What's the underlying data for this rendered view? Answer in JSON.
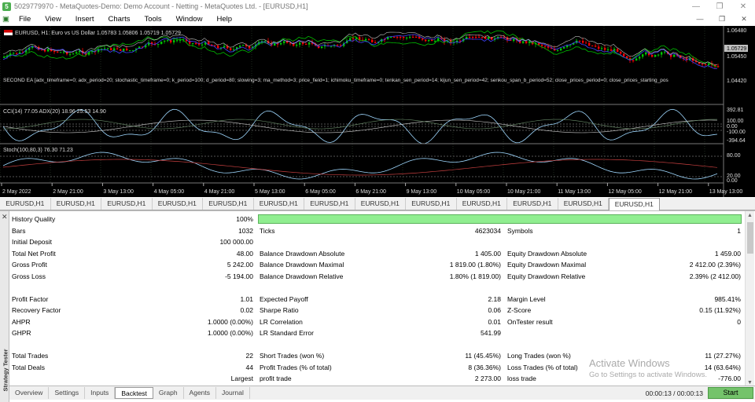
{
  "window": {
    "title": "5029779970 - MetaQuotes-Demo: Demo Account - Netting - MetaQuotes Ltd. - [EURUSD,H1]"
  },
  "menu": [
    "File",
    "View",
    "Insert",
    "Charts",
    "Tools",
    "Window",
    "Help"
  ],
  "chart": {
    "header": "EURUSD, H1:  Euro vs US Dollar  1.05783 1.05806 1.05719 1.05729",
    "price_current": "1.05729",
    "price_labels": [
      "1.06480",
      "1.05450",
      "1.04420"
    ],
    "ea_label": "SECOND EA [adx_timeframe=0; adx_period=20; stochastic_timeframe=0; k_period=100; d_period=80; slowing=3; ma_method=3; price_field=1; ichimoku_timeframe=0; tenkan_sen_period=14; kijun_sen_period=42; senkou_span_b_period=52; close_prices_period=0; close_prices_starting_pos",
    "cci_label": "CCI(14) 77.05 ADX(20) 18.96 25.53 14.90",
    "cci_levels": [
      "392.81",
      "100.00",
      "0.00",
      "-100.00",
      "-394.64"
    ],
    "stoch_label": "Stoch(100,80,3) 76.30 71.23",
    "stoch_levels": [
      "80.00",
      "20.00",
      "0.00"
    ],
    "time_labels": [
      "2 May 2022",
      "2 May 21:00",
      "3 May 13:00",
      "4 May 05:00",
      "4 May 21:00",
      "5 May 13:00",
      "6 May 05:00",
      "6 May 21:00",
      "9 May 13:00",
      "10 May 05:00",
      "10 May 21:00",
      "11 May 13:00",
      "12 May 05:00",
      "12 May 21:00",
      "13 May 13:00"
    ],
    "colors": {
      "bull": "#00c800",
      "bear": "#ff0000",
      "price_line": "#00ff00"
    }
  },
  "chart_tabs": [
    "EURUSD,H1",
    "EURUSD,H1",
    "EURUSD,H1",
    "EURUSD,H1",
    "EURUSD,H1",
    "EURUSD,H1",
    "EURUSD,H1",
    "EURUSD,H1",
    "EURUSD,H1",
    "EURUSD,H1",
    "EURUSD,H1",
    "EURUSD,H1",
    "EURUSD,H1"
  ],
  "active_chart_tab": 12,
  "report": {
    "history_quality": {
      "label": "History Quality",
      "value": "100%",
      "fraction": 1.0
    },
    "rows": [
      [
        [
          "Bars",
          "1032"
        ],
        [
          "Ticks",
          "4623034"
        ],
        [
          "Symbols",
          "1"
        ]
      ],
      [
        [
          "Initial Deposit",
          "100 000.00"
        ],
        [
          "",
          ""
        ],
        [
          "",
          ""
        ]
      ],
      [
        [
          "Total Net Profit",
          "48.00"
        ],
        [
          "Balance Drawdown Absolute",
          "1 405.00"
        ],
        [
          "Equity Drawdown Absolute",
          "1 459.00"
        ]
      ],
      [
        [
          "Gross Profit",
          "5 242.00"
        ],
        [
          "Balance Drawdown Maximal",
          "1 819.00 (1.80%)"
        ],
        [
          "Equity Drawdown Maximal",
          "2 412.00 (2.39%)"
        ]
      ],
      [
        [
          "Gross Loss",
          "-5 194.00"
        ],
        [
          "Balance Drawdown Relative",
          "1.80% (1 819.00)"
        ],
        [
          "Equity Drawdown Relative",
          "2.39% (2 412.00)"
        ]
      ],
      null,
      [
        [
          "Profit Factor",
          "1.01"
        ],
        [
          "Expected Payoff",
          "2.18"
        ],
        [
          "Margin Level",
          "985.41%"
        ]
      ],
      [
        [
          "Recovery Factor",
          "0.02"
        ],
        [
          "Sharpe Ratio",
          "0.06"
        ],
        [
          "Z-Score",
          "0.15 (11.92%)"
        ]
      ],
      [
        [
          "AHPR",
          "1.0000 (0.00%)"
        ],
        [
          "LR Correlation",
          "0.01"
        ],
        [
          "OnTester result",
          "0"
        ]
      ],
      [
        [
          "GHPR",
          "1.0000 (0.00%)"
        ],
        [
          "LR Standard Error",
          "541.99"
        ],
        [
          "",
          ""
        ]
      ],
      null,
      [
        [
          "Total Trades",
          "22"
        ],
        [
          "Short Trades (won %)",
          "11 (45.45%)"
        ],
        [
          "Long Trades (won %)",
          "11 (27.27%)"
        ]
      ],
      [
        [
          "Total Deals",
          "44"
        ],
        [
          "Profit Trades (% of total)",
          "8 (36.36%)"
        ],
        [
          "Loss Trades (% of total)",
          "14 (63.64%)"
        ]
      ],
      [
        [
          "",
          "Largest"
        ],
        [
          "profit trade",
          "2 273.00"
        ],
        [
          "loss trade",
          "-776.00"
        ]
      ]
    ]
  },
  "bottom_tabs": [
    "Overview",
    "Settings",
    "Inputs",
    "Backtest",
    "Graph",
    "Agents",
    "Journal"
  ],
  "active_bottom_tab": "Backtest",
  "side_label": "Strategy Tester",
  "timer": "00:00:13 / 00:00:13",
  "start_label": "Start",
  "watermark": {
    "line1": "Activate Windows",
    "line2": "Go to Settings to activate Windows."
  }
}
